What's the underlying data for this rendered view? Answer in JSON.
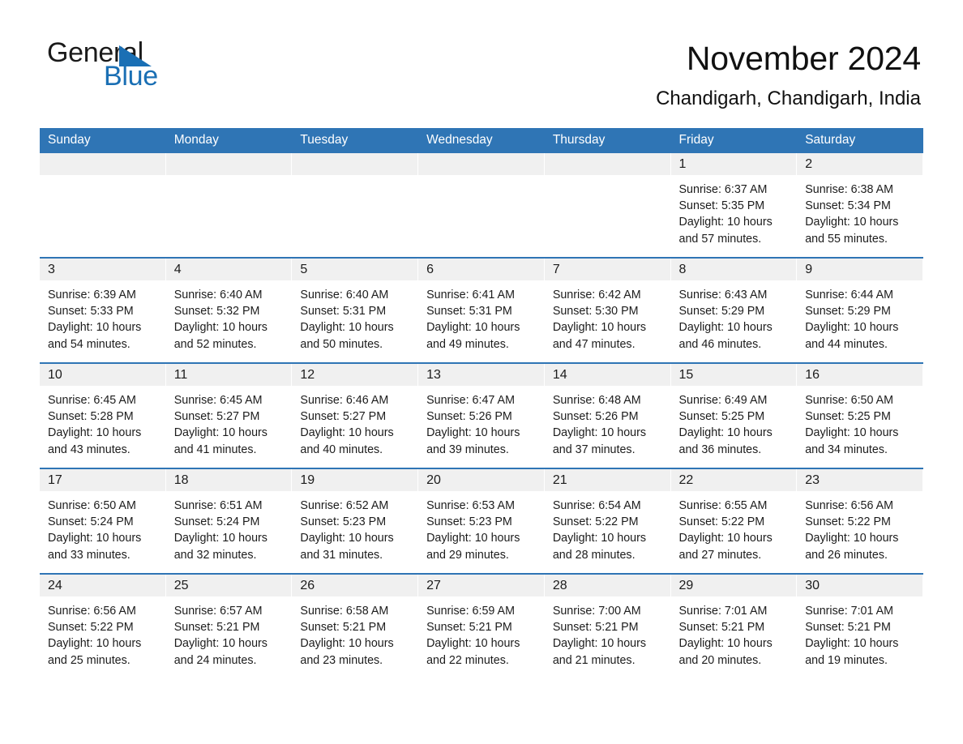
{
  "brand": {
    "name_part1": "General",
    "name_part2": "Blue",
    "triangle_color": "#1a6fb4"
  },
  "header": {
    "month_title": "November 2024",
    "location": "Chandigarh, Chandigarh, India"
  },
  "theme": {
    "header_blue": "#2f75b5",
    "band_gray": "#f0f0f0",
    "text": "#1c1c1c"
  },
  "weekday_headers": [
    "Sunday",
    "Monday",
    "Tuesday",
    "Wednesday",
    "Thursday",
    "Friday",
    "Saturday"
  ],
  "labels": {
    "sunrise_prefix": "Sunrise:",
    "sunset_prefix": "Sunset:",
    "daylight_prefix": "Daylight:"
  },
  "weeks": [
    [
      {
        "day": "",
        "empty": true
      },
      {
        "day": "",
        "empty": true
      },
      {
        "day": "",
        "empty": true
      },
      {
        "day": "",
        "empty": true
      },
      {
        "day": "",
        "empty": true
      },
      {
        "day": "1",
        "sunrise": "Sunrise: 6:37 AM",
        "sunset": "Sunset: 5:35 PM",
        "daylight": "Daylight: 10 hours and 57 minutes."
      },
      {
        "day": "2",
        "sunrise": "Sunrise: 6:38 AM",
        "sunset": "Sunset: 5:34 PM",
        "daylight": "Daylight: 10 hours and 55 minutes."
      }
    ],
    [
      {
        "day": "3",
        "sunrise": "Sunrise: 6:39 AM",
        "sunset": "Sunset: 5:33 PM",
        "daylight": "Daylight: 10 hours and 54 minutes."
      },
      {
        "day": "4",
        "sunrise": "Sunrise: 6:40 AM",
        "sunset": "Sunset: 5:32 PM",
        "daylight": "Daylight: 10 hours and 52 minutes."
      },
      {
        "day": "5",
        "sunrise": "Sunrise: 6:40 AM",
        "sunset": "Sunset: 5:31 PM",
        "daylight": "Daylight: 10 hours and 50 minutes."
      },
      {
        "day": "6",
        "sunrise": "Sunrise: 6:41 AM",
        "sunset": "Sunset: 5:31 PM",
        "daylight": "Daylight: 10 hours and 49 minutes."
      },
      {
        "day": "7",
        "sunrise": "Sunrise: 6:42 AM",
        "sunset": "Sunset: 5:30 PM",
        "daylight": "Daylight: 10 hours and 47 minutes."
      },
      {
        "day": "8",
        "sunrise": "Sunrise: 6:43 AM",
        "sunset": "Sunset: 5:29 PM",
        "daylight": "Daylight: 10 hours and 46 minutes."
      },
      {
        "day": "9",
        "sunrise": "Sunrise: 6:44 AM",
        "sunset": "Sunset: 5:29 PM",
        "daylight": "Daylight: 10 hours and 44 minutes."
      }
    ],
    [
      {
        "day": "10",
        "sunrise": "Sunrise: 6:45 AM",
        "sunset": "Sunset: 5:28 PM",
        "daylight": "Daylight: 10 hours and 43 minutes."
      },
      {
        "day": "11",
        "sunrise": "Sunrise: 6:45 AM",
        "sunset": "Sunset: 5:27 PM",
        "daylight": "Daylight: 10 hours and 41 minutes."
      },
      {
        "day": "12",
        "sunrise": "Sunrise: 6:46 AM",
        "sunset": "Sunset: 5:27 PM",
        "daylight": "Daylight: 10 hours and 40 minutes."
      },
      {
        "day": "13",
        "sunrise": "Sunrise: 6:47 AM",
        "sunset": "Sunset: 5:26 PM",
        "daylight": "Daylight: 10 hours and 39 minutes."
      },
      {
        "day": "14",
        "sunrise": "Sunrise: 6:48 AM",
        "sunset": "Sunset: 5:26 PM",
        "daylight": "Daylight: 10 hours and 37 minutes."
      },
      {
        "day": "15",
        "sunrise": "Sunrise: 6:49 AM",
        "sunset": "Sunset: 5:25 PM",
        "daylight": "Daylight: 10 hours and 36 minutes."
      },
      {
        "day": "16",
        "sunrise": "Sunrise: 6:50 AM",
        "sunset": "Sunset: 5:25 PM",
        "daylight": "Daylight: 10 hours and 34 minutes."
      }
    ],
    [
      {
        "day": "17",
        "sunrise": "Sunrise: 6:50 AM",
        "sunset": "Sunset: 5:24 PM",
        "daylight": "Daylight: 10 hours and 33 minutes."
      },
      {
        "day": "18",
        "sunrise": "Sunrise: 6:51 AM",
        "sunset": "Sunset: 5:24 PM",
        "daylight": "Daylight: 10 hours and 32 minutes."
      },
      {
        "day": "19",
        "sunrise": "Sunrise: 6:52 AM",
        "sunset": "Sunset: 5:23 PM",
        "daylight": "Daylight: 10 hours and 31 minutes."
      },
      {
        "day": "20",
        "sunrise": "Sunrise: 6:53 AM",
        "sunset": "Sunset: 5:23 PM",
        "daylight": "Daylight: 10 hours and 29 minutes."
      },
      {
        "day": "21",
        "sunrise": "Sunrise: 6:54 AM",
        "sunset": "Sunset: 5:22 PM",
        "daylight": "Daylight: 10 hours and 28 minutes."
      },
      {
        "day": "22",
        "sunrise": "Sunrise: 6:55 AM",
        "sunset": "Sunset: 5:22 PM",
        "daylight": "Daylight: 10 hours and 27 minutes."
      },
      {
        "day": "23",
        "sunrise": "Sunrise: 6:56 AM",
        "sunset": "Sunset: 5:22 PM",
        "daylight": "Daylight: 10 hours and 26 minutes."
      }
    ],
    [
      {
        "day": "24",
        "sunrise": "Sunrise: 6:56 AM",
        "sunset": "Sunset: 5:22 PM",
        "daylight": "Daylight: 10 hours and 25 minutes."
      },
      {
        "day": "25",
        "sunrise": "Sunrise: 6:57 AM",
        "sunset": "Sunset: 5:21 PM",
        "daylight": "Daylight: 10 hours and 24 minutes."
      },
      {
        "day": "26",
        "sunrise": "Sunrise: 6:58 AM",
        "sunset": "Sunset: 5:21 PM",
        "daylight": "Daylight: 10 hours and 23 minutes."
      },
      {
        "day": "27",
        "sunrise": "Sunrise: 6:59 AM",
        "sunset": "Sunset: 5:21 PM",
        "daylight": "Daylight: 10 hours and 22 minutes."
      },
      {
        "day": "28",
        "sunrise": "Sunrise: 7:00 AM",
        "sunset": "Sunset: 5:21 PM",
        "daylight": "Daylight: 10 hours and 21 minutes."
      },
      {
        "day": "29",
        "sunrise": "Sunrise: 7:01 AM",
        "sunset": "Sunset: 5:21 PM",
        "daylight": "Daylight: 10 hours and 20 minutes."
      },
      {
        "day": "30",
        "sunrise": "Sunrise: 7:01 AM",
        "sunset": "Sunset: 5:21 PM",
        "daylight": "Daylight: 10 hours and 19 minutes."
      }
    ]
  ]
}
